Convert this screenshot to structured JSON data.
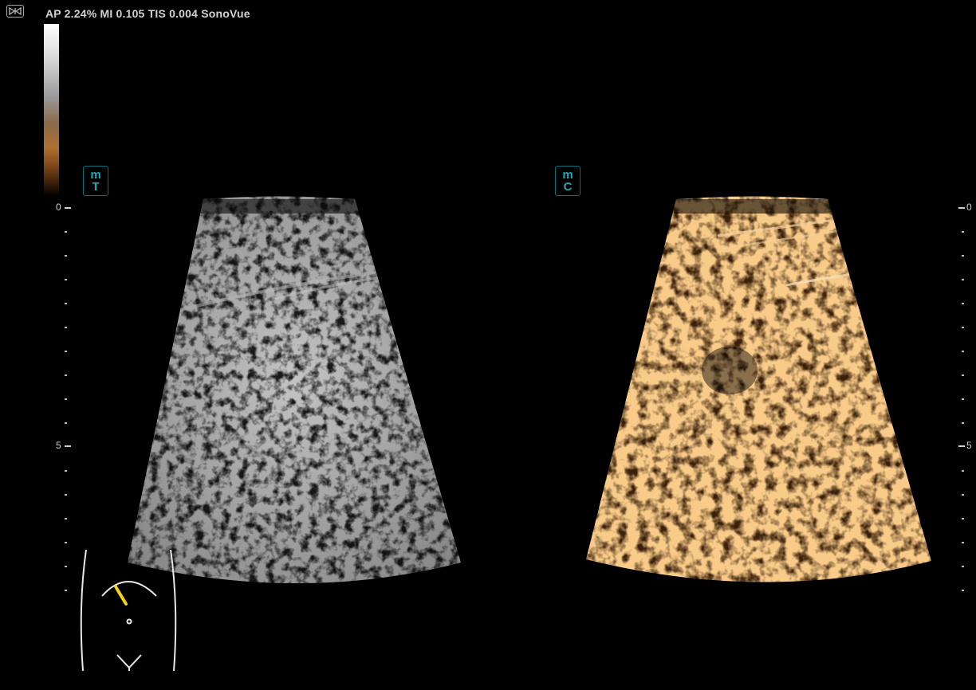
{
  "header": {
    "params": "AP 2.24%  MI 0.105 TIS 0.004  SonoVue",
    "icon": "bowtie-icon"
  },
  "left_view": {
    "badge_top": "m",
    "badge_bottom": "T"
  },
  "right_view": {
    "badge_top": "m",
    "badge_bottom": "C"
  },
  "depth_scale": {
    "labels": [
      "0",
      "5"
    ]
  },
  "colors": {
    "badge": "#1fa7b4",
    "probe_marker": "#f2d21a",
    "contrast_tint": "#c8822e"
  }
}
